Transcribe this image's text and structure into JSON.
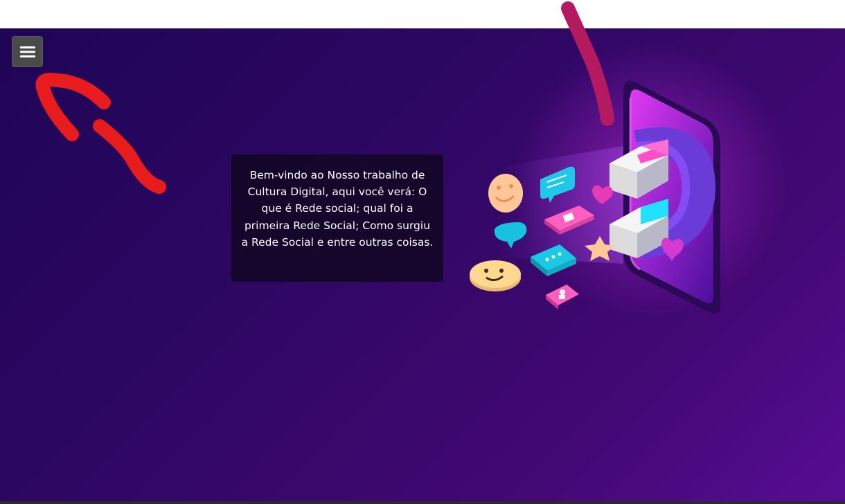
{
  "menu": {
    "icon": "hamburger-menu-icon"
  },
  "hero": {
    "welcome_text": "Bem-vindo ao Nosso trabalho de Cultura Digital, aqui você verá: O que é Rede social; qual foi a primeira Rede Social; Como surgiu a Rede Social e entre outras coisas."
  },
  "colors": {
    "background_start": "#1e0556",
    "background_end": "#560d93",
    "annotation_red": "#e81c1c",
    "annotation_magenta": "#b41a5f",
    "menu_button": "#4a4a4a"
  }
}
